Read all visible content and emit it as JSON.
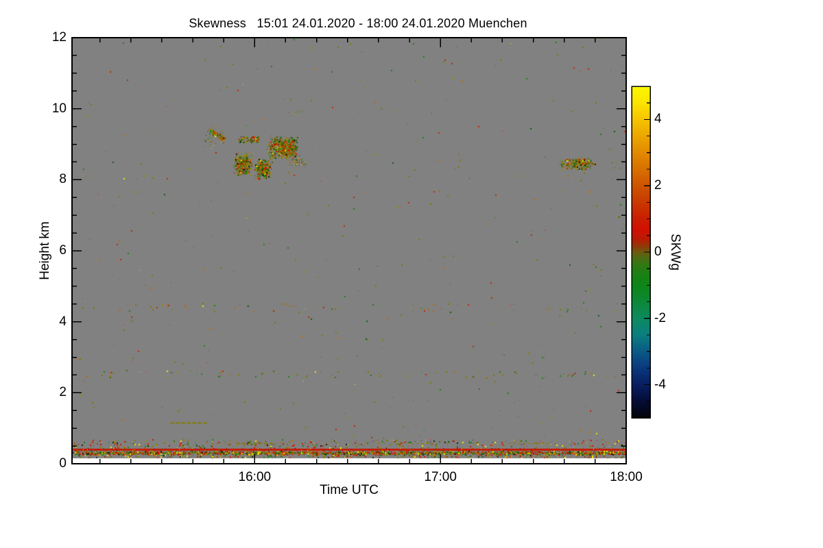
{
  "title": "Skewness   15:01 24.01.2020 - 18:00 24.01.2020 Muenchen",
  "chart_data": {
    "type": "heatmap",
    "title": "Skewness   15:01 24.01.2020 - 18:00 24.01.2020 Muenchen",
    "xlabel": "Time UTC",
    "ylabel": "Height km",
    "x_range": [
      "15:01",
      "18:00"
    ],
    "x_total_minutes": 179,
    "y_range_km": [
      0,
      12
    ],
    "grid": false,
    "x_ticks": [
      {
        "t": 59,
        "label": "16:00"
      },
      {
        "t": 119,
        "label": "17:00"
      },
      {
        "t": 179,
        "label": "18:00"
      }
    ],
    "x_minor_ticks_t": [
      9,
      19,
      29,
      39,
      49,
      69,
      79,
      89,
      99,
      109,
      129,
      139,
      149,
      159,
      169
    ],
    "y_ticks": [
      {
        "h": 0,
        "label": "0"
      },
      {
        "h": 2,
        "label": "2"
      },
      {
        "h": 4,
        "label": "4"
      },
      {
        "h": 6,
        "label": "6"
      },
      {
        "h": 8,
        "label": "8"
      },
      {
        "h": 10,
        "label": "10"
      },
      {
        "h": 12,
        "label": "12"
      }
    ],
    "y_minor_step": 0.5,
    "colorbar": {
      "label": "SKWg",
      "vmin": -5,
      "vmax": 5,
      "ticks": [
        {
          "v": 4,
          "label": "4"
        },
        {
          "v": 2,
          "label": "2"
        },
        {
          "v": 0,
          "label": "0"
        },
        {
          "v": -2,
          "label": "-2"
        },
        {
          "v": -4,
          "label": "-4"
        }
      ],
      "minor_step": 0.5,
      "stops": [
        [
          0.0,
          "#FCF800"
        ],
        [
          0.05,
          "#FBE400"
        ],
        [
          0.1,
          "#F6C400"
        ],
        [
          0.15,
          "#ECA600"
        ],
        [
          0.2,
          "#E28A00"
        ],
        [
          0.25,
          "#D87000"
        ],
        [
          0.3,
          "#CE5400"
        ],
        [
          0.35,
          "#C93800"
        ],
        [
          0.4,
          "#C91E00"
        ],
        [
          0.43,
          "#D21000"
        ],
        [
          0.46,
          "#BA1A02"
        ],
        [
          0.485,
          "#8C3C08"
        ],
        [
          0.5,
          "#6E5A10"
        ],
        [
          0.515,
          "#506912"
        ],
        [
          0.54,
          "#2F7A12"
        ],
        [
          0.57,
          "#188113"
        ],
        [
          0.6,
          "#0E8517"
        ],
        [
          0.65,
          "#0C8838"
        ],
        [
          0.7,
          "#0C8A5E"
        ],
        [
          0.75,
          "#0B7E80"
        ],
        [
          0.8,
          "#0A5A86"
        ],
        [
          0.85,
          "#0A387E"
        ],
        [
          0.9,
          "#081E60"
        ],
        [
          0.95,
          "#040C36"
        ],
        [
          1.0,
          "#020308"
        ]
      ]
    },
    "no_data_color": "#818181",
    "below_range_color": "#FFFFFF",
    "frame_color": "#000000",
    "palettes": {
      "cloud": [
        [
          "#7E7A00",
          30
        ],
        [
          "#938E00",
          12
        ],
        [
          "#565400",
          10
        ],
        [
          "#1E7D14",
          14
        ],
        [
          "#0F5A10",
          6
        ],
        [
          "#C22600",
          14
        ],
        [
          "#DC2000",
          5
        ],
        [
          "#C36A00",
          8
        ],
        [
          "#EDED00",
          4
        ],
        [
          "#1C1A04",
          7
        ],
        [
          "#0C7A60",
          1
        ]
      ],
      "lowband": [
        [
          "#C81800",
          22
        ],
        [
          "#DC2000",
          8
        ],
        [
          "#1E7D14",
          16
        ],
        [
          "#0F5A10",
          5
        ],
        [
          "#7E7A00",
          16
        ],
        [
          "#938E00",
          8
        ],
        [
          "#EDED00",
          8
        ],
        [
          "#FFF000",
          3
        ],
        [
          "#C36A00",
          10
        ],
        [
          "#1C1A04",
          9
        ],
        [
          "#0C7A60",
          1
        ]
      ],
      "noise": [
        [
          "#7E7A00",
          40
        ],
        [
          "#1E7D14",
          18
        ],
        [
          "#C22600",
          16
        ],
        [
          "#C36A00",
          12
        ],
        [
          "#938E00",
          8
        ],
        [
          "#0F5A10",
          4
        ],
        [
          "#EDED00",
          2
        ]
      ],
      "redspeck": [
        [
          "#8A1200",
          30
        ],
        [
          "#7E7A00",
          20
        ],
        [
          "#EDED00",
          12
        ],
        [
          "#1C1A04",
          14
        ],
        [
          "#C36A00",
          10
        ],
        [
          "#1E7D14",
          8
        ]
      ]
    },
    "features": [
      {
        "name": "background-noise",
        "type": "speckle",
        "t": [
          0,
          179
        ],
        "h": [
          0.2,
          12
        ],
        "count": 480,
        "palette": "noise",
        "dot": [
          1,
          2
        ]
      },
      {
        "name": "row-2.5km",
        "type": "speckle",
        "t": [
          0,
          179
        ],
        "h": [
          2.42,
          2.62
        ],
        "count": 95,
        "palette": "noise",
        "dot": [
          1,
          2
        ]
      },
      {
        "name": "row-4.4km",
        "type": "speckle",
        "t": [
          0,
          179
        ],
        "h": [
          4.28,
          4.52
        ],
        "count": 75,
        "palette": "noise",
        "dot": [
          1,
          2
        ]
      },
      {
        "name": "band-0.5km",
        "type": "speckle",
        "t": [
          0,
          179
        ],
        "h": [
          0.42,
          0.68
        ],
        "count": 430,
        "palette": "lowband",
        "dot": [
          1,
          2
        ]
      },
      {
        "name": "band-0.2km",
        "type": "speckle",
        "t": [
          0,
          179
        ],
        "h": [
          0.17,
          0.25
        ],
        "count": 320,
        "palette": "lowband",
        "dot": [
          1,
          2
        ]
      },
      {
        "name": "dense-speckle-line-0.3km",
        "type": "speckle",
        "t": [
          0,
          179
        ],
        "h": [
          0.26,
          0.35
        ],
        "count": 2500,
        "palette": "lowband",
        "dot": [
          1,
          2
        ]
      },
      {
        "name": "red-line-0.4km",
        "type": "solid_band",
        "t": [
          0,
          179
        ],
        "h": [
          0.365,
          0.43
        ],
        "color": "#C81800"
      },
      {
        "name": "red-line-speckles",
        "type": "speckle",
        "t": [
          0,
          179
        ],
        "h": [
          0.36,
          0.43
        ],
        "count": 140,
        "palette": "redspeck",
        "dot": [
          1,
          1
        ]
      },
      {
        "name": "cloud-main",
        "type": "cluster",
        "t": [
          62.5,
          73.5
        ],
        "h": [
          8.57,
          9.24
        ],
        "count": 680,
        "palette": "cloud",
        "dot": [
          1,
          2
        ]
      },
      {
        "name": "cloud-funnel",
        "type": "cluster",
        "t": [
          52.0,
          58.2
        ],
        "h": [
          8.1,
          8.78
        ],
        "count": 400,
        "palette": "cloud",
        "dot": [
          1,
          2
        ]
      },
      {
        "name": "cloud-blob",
        "type": "cluster",
        "t": [
          58.7,
          64.7
        ],
        "h": [
          8.01,
          8.62
        ],
        "count": 340,
        "palette": "cloud",
        "dot": [
          1,
          2
        ]
      },
      {
        "name": "cloud-streak-9.1km",
        "type": "speckle",
        "t": [
          53.8,
          60.5
        ],
        "h": [
          9.05,
          9.22
        ],
        "count": 115,
        "palette": "cloud",
        "dot": [
          1,
          2
        ]
      },
      {
        "name": "cloud-diag-streak",
        "type": "diag",
        "from": [
          44.3,
          9.38
        ],
        "to": [
          49.4,
          9.15
        ],
        "count": 95,
        "jitter": 0.07,
        "palette": "cloud",
        "dot": [
          1,
          2
        ]
      },
      {
        "name": "cloud-diag-halo",
        "type": "cluster",
        "t": [
          41.5,
          50.5
        ],
        "h": [
          8.85,
          9.55
        ],
        "count": 65,
        "palette": "cloud",
        "dot": [
          1,
          1
        ]
      },
      {
        "name": "cloud-east-sparse",
        "type": "cluster",
        "t": [
          69.0,
          76.5
        ],
        "h": [
          8.3,
          8.75
        ],
        "count": 85,
        "palette": "cloud",
        "dot": [
          1,
          1
        ]
      },
      {
        "name": "cloud-1740",
        "type": "cluster",
        "t": [
          157.0,
          169.5
        ],
        "h": [
          8.26,
          8.64
        ],
        "count": 310,
        "palette": "cloud",
        "dot": [
          1,
          2
        ]
      },
      {
        "name": "cloud-edge-dots",
        "type": "speckle",
        "t": [
          173.5,
          178.5
        ],
        "h": [
          8.3,
          8.55
        ],
        "count": 12,
        "palette": "cloud",
        "dot": [
          1,
          1
        ]
      },
      {
        "name": "dots-9.9km",
        "type": "speckle",
        "t": [
          70,
          75
        ],
        "h": [
          9.8,
          10.0
        ],
        "count": 12,
        "palette": "noise",
        "dot": [
          1,
          1
        ]
      },
      {
        "name": "dash-1.2km",
        "type": "dash",
        "t": [
          31.7,
          43.9
        ],
        "h": 1.165,
        "color": "#827E00",
        "dash": [
          6,
          2
        ],
        "thick": 2
      },
      {
        "name": "dash-0.6km-a",
        "type": "dash",
        "t": [
          53.2,
          65.4
        ],
        "h": 0.585,
        "color": "#827E00",
        "dash": [
          5,
          3
        ],
        "thick": 2
      },
      {
        "name": "dash-0.6km-b",
        "type": "dash",
        "t": [
          105.0,
          118.5
        ],
        "h": 0.575,
        "color": "#827E00",
        "dash": [
          3,
          4
        ],
        "thick": 1
      },
      {
        "name": "dash-0.6km-c",
        "type": "dash",
        "t": [
          141.0,
          154.0
        ],
        "h": 0.575,
        "color": "#827E00",
        "dash": [
          4,
          3
        ],
        "thick": 1
      },
      {
        "name": "below-range-band",
        "type": "solid_band",
        "t": [
          0,
          179
        ],
        "h": [
          0,
          0.155
        ],
        "color": "#FFFFFF"
      }
    ]
  }
}
